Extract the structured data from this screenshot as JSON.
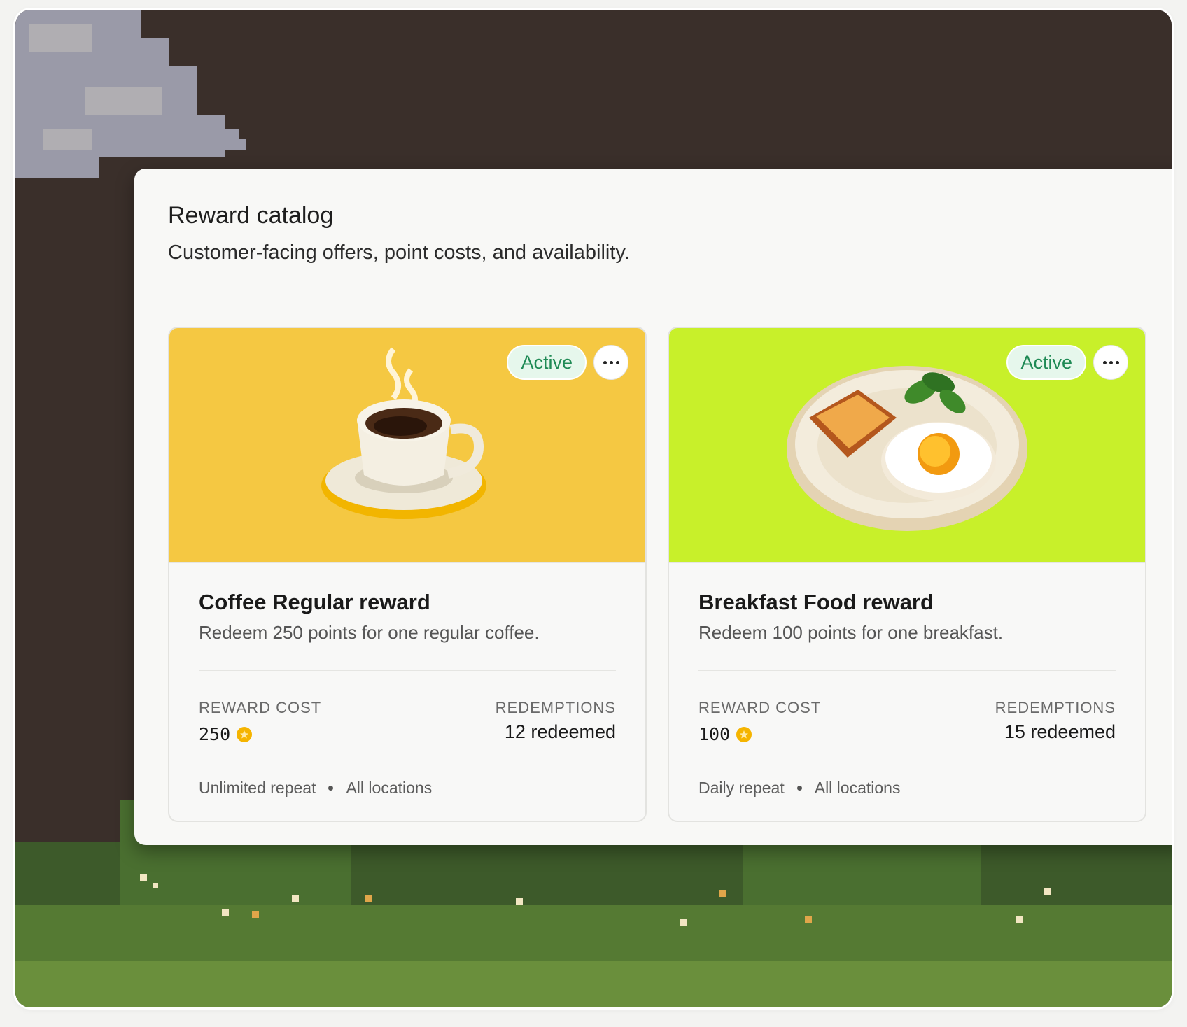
{
  "catalog": {
    "title": "Reward catalog",
    "subtitle": "Customer-facing offers, point costs, and availability."
  },
  "labels": {
    "reward_cost": "REWARD COST",
    "redemptions": "REDEMPTIONS"
  },
  "rewards": [
    {
      "status": "Active",
      "title": "Coffee Regular reward",
      "description": "Redeem 250 points for one regular coffee.",
      "cost": "250",
      "redemptions": "12 redeemed",
      "repeat": "Unlimited repeat",
      "locations": "All locations",
      "hero_color": "#f5c842",
      "illustration": "coffee-cup-illustration"
    },
    {
      "status": "Active",
      "title": "Breakfast Food reward",
      "description": "Redeem 100 points for one breakfast.",
      "cost": "100",
      "redemptions": "15 redeemed",
      "repeat": "Daily repeat",
      "locations": "All locations",
      "hero_color": "#c8f02a",
      "illustration": "breakfast-plate-illustration"
    }
  ],
  "colors": {
    "status_active_bg": "#e6f7ec",
    "status_active_text": "#1f8a55",
    "coin": "#f5b400",
    "background": "#3a2f2a"
  }
}
